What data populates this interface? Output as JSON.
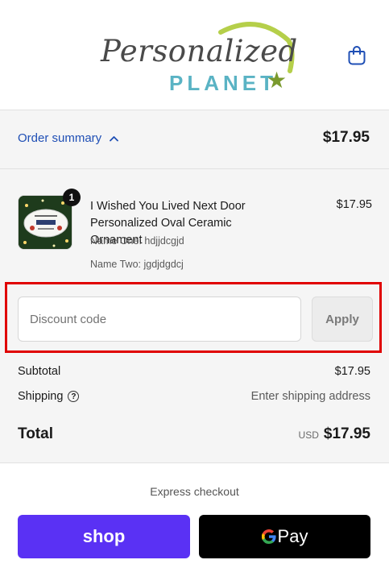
{
  "brand": {
    "script_text": "Personalized",
    "word_text": "PLANET",
    "star": "★",
    "colors": {
      "script": "#4a4a4a",
      "planet": "#5ab3c4",
      "arc": "#b5cf4a",
      "star": "#7a9a2e"
    }
  },
  "header": {
    "cart_icon": "shopping-bag-icon"
  },
  "summary": {
    "toggle_label": "Order summary",
    "total": "$17.95",
    "link_color": "#1f4fb5"
  },
  "product": {
    "quantity": "1",
    "title": "I Wished You Lived Next Door Personalized Oval Ceramic Ornament",
    "price": "$17.95",
    "variant_one": "Name One: hdjjdcgjd",
    "variant_two": "Name Two: jgdjdgdcj"
  },
  "discount": {
    "placeholder": "Discount code",
    "value": "",
    "apply_label": "Apply",
    "highlight_color": "#e00000"
  },
  "totals": {
    "subtotal_label": "Subtotal",
    "subtotal_value": "$17.95",
    "shipping_label": "Shipping",
    "shipping_help": "?",
    "shipping_value": "Enter shipping address",
    "total_label": "Total",
    "currency": "USD",
    "total_value": "$17.95"
  },
  "express": {
    "label": "Express checkout",
    "shop_label": "shop",
    "shop_color": "#5a31f4",
    "gpay_g": "G",
    "gpay_label": "Pay"
  }
}
